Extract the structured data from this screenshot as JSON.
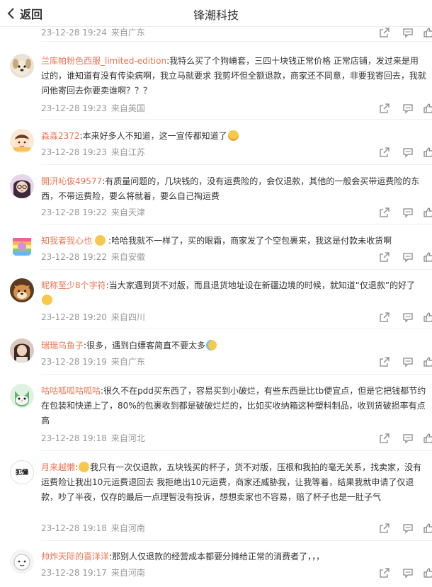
{
  "header": {
    "back_label": "返回",
    "title": "锋潮科技"
  },
  "comments": [
    {
      "id": 0,
      "user": "",
      "text": "",
      "time": "23-12-28 19:24",
      "from": "来自广东",
      "avatar": "none"
    },
    {
      "id": 1,
      "user": "兰库帕粉色西服_limited-edition",
      "text": "我特么买了个狗嵴套，三四十块钱正常价格 正常店铺，发过来是用过的，谁知道有没有传染病啊，我立马就要求 我剪坏但全额退款，商家还不同意，非要我寄回去，我就问他寄回去你要卖谁啊？？？",
      "time": "23-12-28 19:23",
      "from": "来自英国",
      "avatar": "dog"
    },
    {
      "id": 2,
      "user": "淼淼2372",
      "text": "本来好多人不知道，这一宣传都知道了",
      "emoji": "laugh",
      "time": "23-12-28 19:23",
      "from": "来自江苏",
      "avatar": "cartoon-girl"
    },
    {
      "id": 3,
      "user": "開汧吣伖49577",
      "text": "有质量问题的，几块钱的，没有运费险的，会仅退款，其他的一般会买带运费险的东西，不带运费险，要么将就着，要么自己掏运费",
      "time": "23-12-28 19:22",
      "from": "来自天津",
      "avatar": "glasses-girl"
    },
    {
      "id": 4,
      "user": "知我者我心也",
      "text": "哈哈我就不一样了，买的眼霜，商家发了个空包裹来，我这是付款未收货啊",
      "time": "23-12-28 19:22",
      "from": "来自安徽",
      "avatar": "rainbow"
    },
    {
      "id": 5,
      "user": "昵称至少8个字符",
      "text": "当大家遇到货不对版，而且退货地址设在新疆边境的时候，就知道“仅退款”的好了",
      "time": "23-12-28 19:20",
      "from": "来自四川",
      "avatar": "shiba"
    },
    {
      "id": 6,
      "user": "瑞瑞乌鱼子",
      "text": "很多，遇到白嫖客简直不要太多",
      "time": "23-12-28 19:19",
      "from": "来自广东",
      "avatar": "girl"
    },
    {
      "id": 7,
      "user": "咕咕呱呱咕呱咕",
      "text": "很久不在pdd买东西了，容易买到小破烂，有些东西是比tb便宜点，但是它把钱都节约在包装和快递上了，80%的包裹收到都是破破烂烂的，比如买收纳箱这种塑料制品，收到货破损率有点高",
      "time": "23-12-28 19:18",
      "from": "来自河北",
      "avatar": "cat"
    },
    {
      "id": 8,
      "user": "月来越懒",
      "text": "我只有一次仅退款，五块钱买的杯子，货不对版，压根和我拍的毫无关系，找卖家，没有运费险让我出10元运费退回去 我拒绝出10元运费，商家还威胁我，让我等着，结果我就申请了仅退款，吵了半夜，仅存的最后一点理智没有投诉，想想卖家也不容易，赔了杯子也是一肚子气",
      "time": "23-12-28 19:18",
      "from": "来自河南",
      "avatar": "text-logo",
      "avatar_text": "犯懒"
    },
    {
      "id": 9,
      "user": "帅炸天际的喜洋洋",
      "text": "那别人仅退款的经营成本都要分摊给正常的消费者了，，，",
      "time": "23-12-28 19:17",
      "from": "来自河南",
      "avatar": "sheep"
    }
  ],
  "icons": {
    "share": "share-icon",
    "comment": "comment-icon",
    "like": "like-icon"
  },
  "colors": {
    "username": "#eb7350",
    "meta": "#999999",
    "text": "#333333"
  }
}
